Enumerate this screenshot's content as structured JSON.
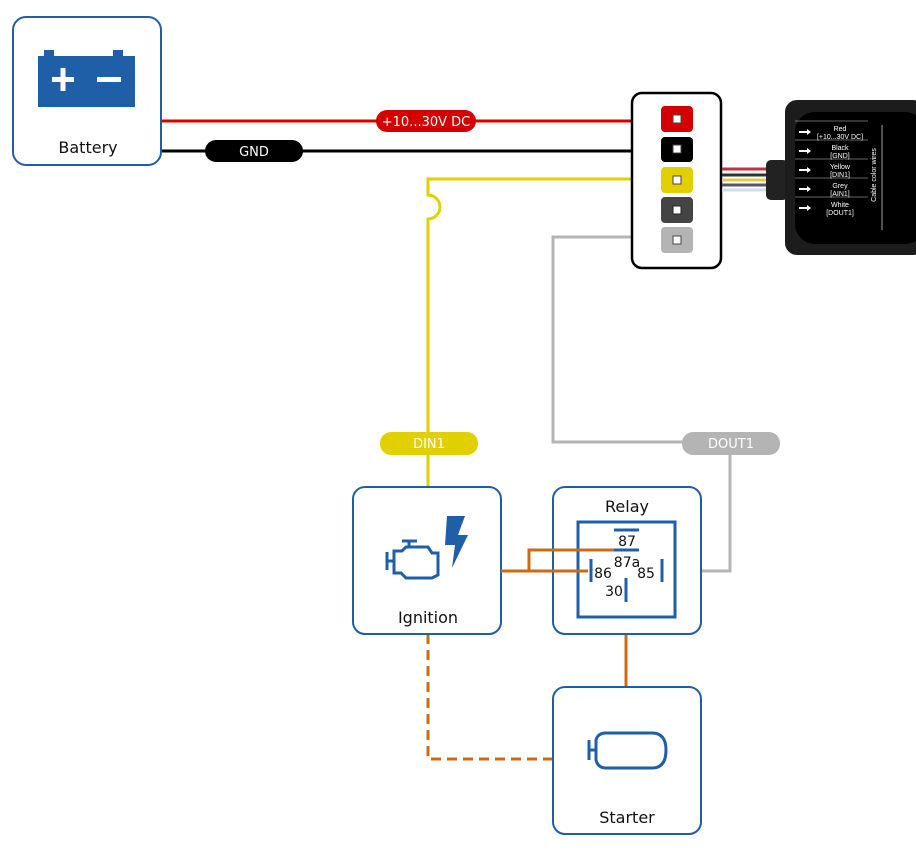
{
  "nodes": {
    "battery": {
      "label": "Battery"
    },
    "ignition": {
      "label": "Ignition"
    },
    "relay": {
      "label": "Relay",
      "pins": {
        "p87": "87",
        "p87a": "87a",
        "p86": "86",
        "p85": "85",
        "p30": "30"
      }
    },
    "starter": {
      "label": "Starter"
    }
  },
  "wires": {
    "power": {
      "label": "+10...30V DC",
      "color": "#d40000"
    },
    "gnd": {
      "label": "GND",
      "color": "#000000"
    },
    "din1": {
      "label": "DIN1",
      "color": "#e2cf00"
    },
    "dout1": {
      "label": "DOUT1",
      "color": "#b4b4b4"
    },
    "relay_wire": {
      "color": "#d06a10"
    }
  },
  "device": {
    "title": "Cable color wires",
    "rows": [
      {
        "color": "Red",
        "signal": "[+10...30V DC]"
      },
      {
        "color": "Black",
        "signal": "[GND]"
      },
      {
        "color": "Yellow",
        "signal": "[DIN1]"
      },
      {
        "color": "Grey",
        "signal": "[AIN1]"
      },
      {
        "color": "White",
        "signal": "[DOUT1]"
      }
    ]
  },
  "accent": "#1f5fa8"
}
